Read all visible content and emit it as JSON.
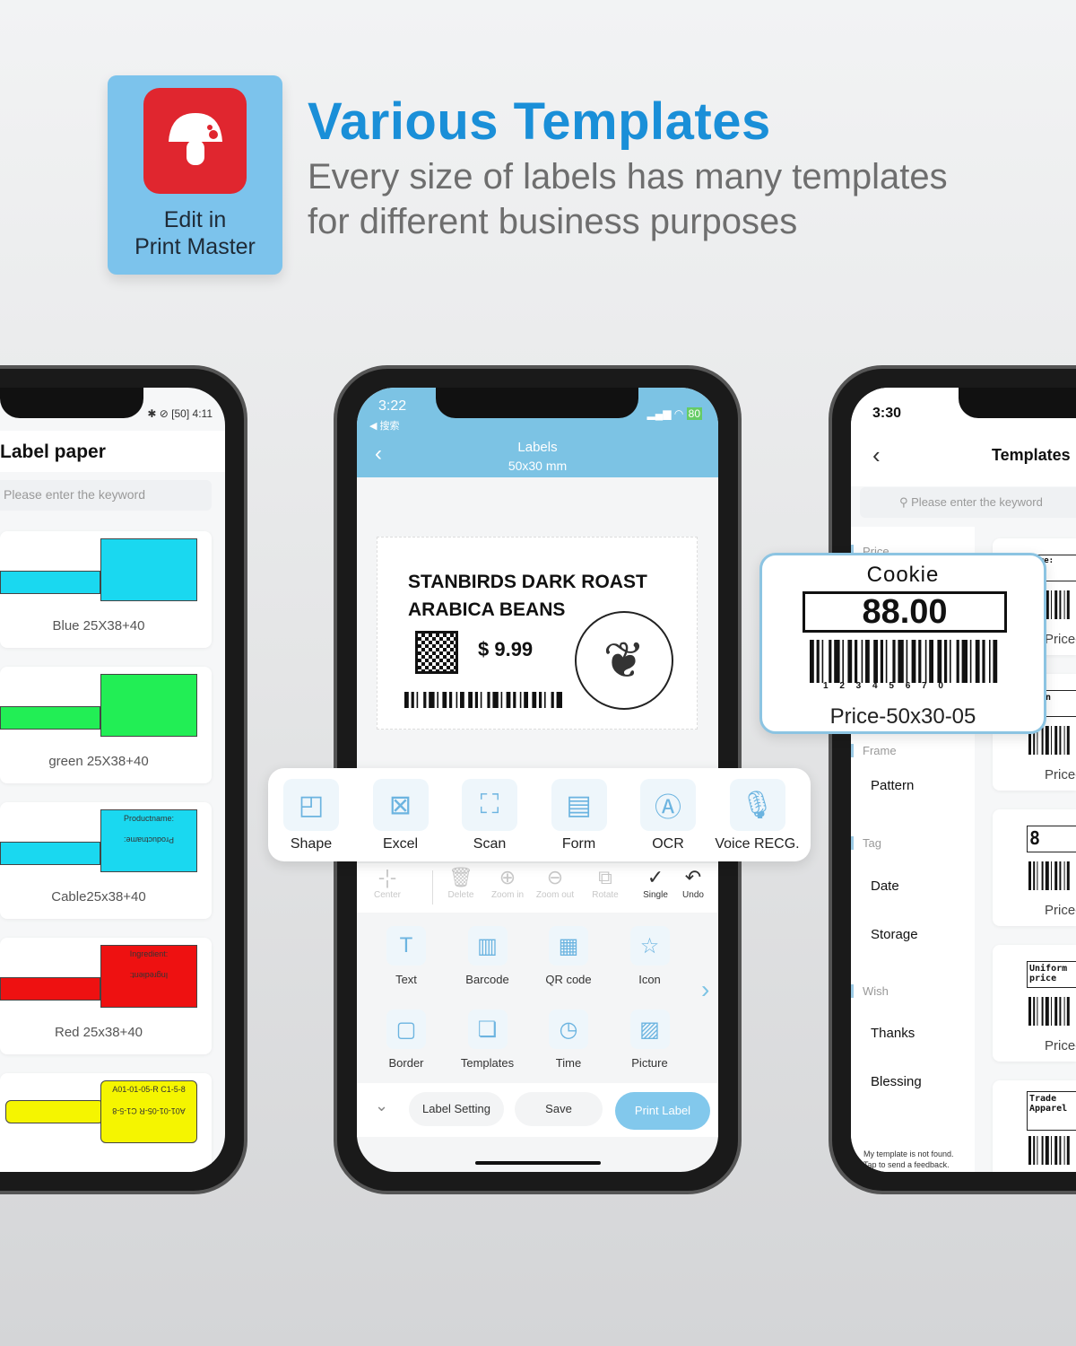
{
  "header": {
    "badge_text_line1": "Edit in",
    "badge_text_line2": "Print Master",
    "title": "Various Templates",
    "subtitle_line1": "Every size of labels has many templates",
    "subtitle_line2": "for different business purposes",
    "title_color": "#1a8fd8",
    "badge_color": "#7cc3ec",
    "app_icon_color": "#e0262f",
    "app_icon": "mushroom-icon"
  },
  "left_phone": {
    "status_time": "4:11",
    "battery": "50",
    "title": "Label paper",
    "search_placeholder": "Please enter the keyword",
    "items": [
      {
        "name": "Blue 25X38+40",
        "color": "#1ad8f0",
        "text_top": "",
        "text_bottom": ""
      },
      {
        "name": "green 25X38+40",
        "color": "#22ee55",
        "text_top": "",
        "text_bottom": ""
      },
      {
        "name": "Cable25x38+40",
        "color": "#1ad8f0",
        "text_top": "Productname:",
        "text_bottom": "Productname:"
      },
      {
        "name": "Red 25x38+40",
        "color": "#ee1111",
        "text_top": "Ingredient:",
        "text_bottom": "Ingredient:"
      },
      {
        "name": "",
        "color": "#f5f500",
        "text_top": "A01-01-05-R C1-5-8",
        "text_bottom": "A01-01-05-R C1-5-8"
      }
    ]
  },
  "middle_phone": {
    "status_time": "3:22",
    "back_app": "◀ 搜索",
    "battery": "80",
    "title": "Labels",
    "subtitle": "50x30 mm",
    "header_color": "#7cc3e4",
    "label": {
      "line1": "STANBIRDS DARK ROAST",
      "line2": "ARABICA BEANS",
      "price": "$ 9.99"
    },
    "toolbar": [
      {
        "label": "Center",
        "icon": "center-icon",
        "enabled": false
      },
      {
        "label": "Delete",
        "icon": "trash-icon",
        "enabled": false
      },
      {
        "label": "Zoom in",
        "icon": "zoom-in-icon",
        "enabled": false
      },
      {
        "label": "Zoom out",
        "icon": "zoom-out-icon",
        "enabled": false
      },
      {
        "label": "Rotate",
        "icon": "rotate-icon",
        "enabled": false
      },
      {
        "label": "Single",
        "icon": "check-icon",
        "enabled": true
      },
      {
        "label": "Undo",
        "icon": "undo-icon",
        "enabled": true
      }
    ],
    "tools": [
      {
        "label": "Text",
        "icon": "T"
      },
      {
        "label": "Barcode",
        "icon": "▥"
      },
      {
        "label": "QR code",
        "icon": "▦"
      },
      {
        "label": "Icon",
        "icon": "☆"
      },
      {
        "label": "Border",
        "icon": "▢"
      },
      {
        "label": "Templates",
        "icon": "❏"
      },
      {
        "label": "Time",
        "icon": "◷"
      },
      {
        "label": "Picture",
        "icon": "▨"
      }
    ],
    "bottom": {
      "label_setting": "Label Setting",
      "save": "Save",
      "print": "Print Label",
      "print_color": "#82c8ec"
    }
  },
  "popup_tools": [
    {
      "label": "Shape",
      "icon": "◰"
    },
    {
      "label": "Excel",
      "icon": "⊠"
    },
    {
      "label": "Scan",
      "icon": "⛶"
    },
    {
      "label": "Form",
      "icon": "▤"
    },
    {
      "label": "OCR",
      "icon": "Ⓐ"
    },
    {
      "label": "Voice RECG.",
      "icon": "🎙"
    }
  ],
  "right_phone": {
    "status_time": "3:30",
    "title": "Templates",
    "search_placeholder": "Please enter the keyword",
    "categories": [
      {
        "type": "head",
        "label": "Price"
      },
      {
        "type": "head",
        "label": "Frame"
      },
      {
        "type": "item",
        "label": "Pattern"
      },
      {
        "type": "head",
        "label": "Tag"
      },
      {
        "type": "item",
        "label": "Date"
      },
      {
        "type": "item",
        "label": "Storage"
      },
      {
        "type": "head",
        "label": "Wish"
      },
      {
        "type": "item",
        "label": "Thanks"
      },
      {
        "type": "item",
        "label": "Blessing"
      }
    ],
    "footer_line1": "My template is not found.",
    "footer_line2": "Tap to send a feedback.",
    "cards": [
      {
        "caption": "Price-",
        "text": "Name:"
      },
      {
        "caption": "Price-",
        "text": "Quin"
      },
      {
        "caption": "Price-",
        "text": "8"
      },
      {
        "caption": "Price-",
        "text": "Uniform price"
      },
      {
        "caption": "",
        "text": "Trade Apparel"
      }
    ]
  },
  "cookie_popup": {
    "name": "Cookie",
    "price": "88.00",
    "barcode_digits": "1 2 3 4 5 6 7 0",
    "caption": "Price-50x30-05"
  }
}
